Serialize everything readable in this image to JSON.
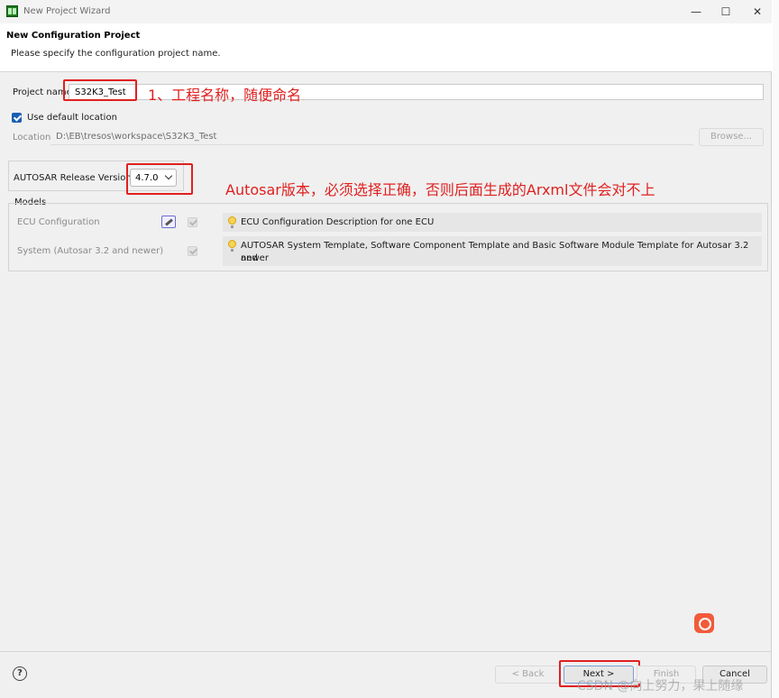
{
  "window": {
    "title": "New Project Wizard",
    "min_glyph": "—",
    "max_glyph": "☐",
    "close_glyph": "✕"
  },
  "header": {
    "title": "New Configuration Project",
    "subtitle": "Please specify the configuration project name."
  },
  "form": {
    "project_name_label": "Project name:",
    "project_name_value": "S32K3_Test",
    "use_default_location_label": "Use default location",
    "use_default_location_checked": true,
    "location_label": "Location:",
    "location_value": "D:\\EB\\tresos\\workspace\\S32K3_Test",
    "browse_label": "Browse...",
    "autosar_release_label": "AUTOSAR Release Version",
    "autosar_release_value": "4.7.0"
  },
  "models": {
    "title": "Models",
    "items": [
      {
        "name": "ECU Configuration",
        "description": "ECU Configuration Description for one ECU",
        "has_edit_icon": true
      },
      {
        "name": "System (Autosar 3.2 and newer)",
        "description_line1": "AUTOSAR System Template, Software Component Template and Basic Software Module Template for Autosar 3.2 and",
        "description_line2": "newer",
        "has_edit_icon": false
      }
    ]
  },
  "annotations": {
    "note_project": "1、工程名称，随便命名",
    "note_autosar": "Autosar版本，必须选择正确，否则后面生成的Arxml文件会对不上"
  },
  "footer": {
    "help_glyph": "?",
    "back_label": "< Back",
    "next_label": "Next >",
    "finish_label": "Finish",
    "cancel_label": "Cancel"
  },
  "watermark": "CSDN @向上努力，果上随缘",
  "colors": {
    "annotation_red": "#e02020",
    "checkbox_blue": "#1a5fb4"
  }
}
